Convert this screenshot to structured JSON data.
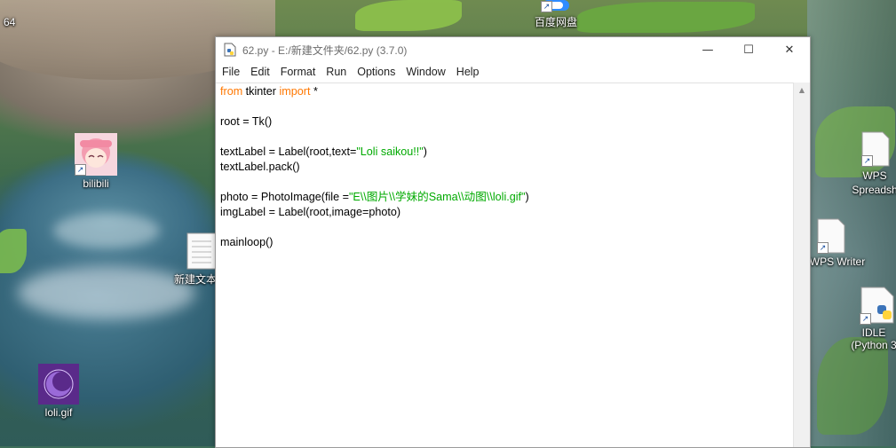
{
  "desktop": {
    "top_left_partial": "64",
    "top_center_icon_label": "百度网盘",
    "icons": [
      {
        "label": "bilibili"
      },
      {
        "label": "新建文本"
      },
      {
        "label": "loli.gif"
      },
      {
        "label": "WPS Spreadsh"
      },
      {
        "label": "WPS Writer"
      },
      {
        "label_line1": "IDLE",
        "label_line2": "(Python 3"
      }
    ]
  },
  "window": {
    "title": "62.py - E:/新建文件夹/62.py (3.7.0)",
    "controls": {
      "minimize": "—",
      "maximize": "☐",
      "close": "✕"
    },
    "menu": [
      "File",
      "Edit",
      "Format",
      "Run",
      "Options",
      "Window",
      "Help"
    ],
    "code": {
      "l1_kw1": "from",
      "l1_mid": " tkinter ",
      "l1_kw2": "import",
      "l1_end": " *",
      "l3": "root = Tk()",
      "l5_pre": "textLabel = Label(root,text=",
      "l5_str": "\"Loli saikou!!\"",
      "l5_post": ")",
      "l6": "textLabel.pack()",
      "l8_pre": "photo = PhotoImage(file =",
      "l8_str": "\"E\\\\图片\\\\学妹的Sama\\\\动图\\\\loli.gif\"",
      "l8_post": ")",
      "l9": "imgLabel = Label(root,image=photo)",
      "l11": "mainloop()"
    }
  },
  "colors": {
    "keyword": "#ff7700",
    "string": "#00aa00"
  }
}
